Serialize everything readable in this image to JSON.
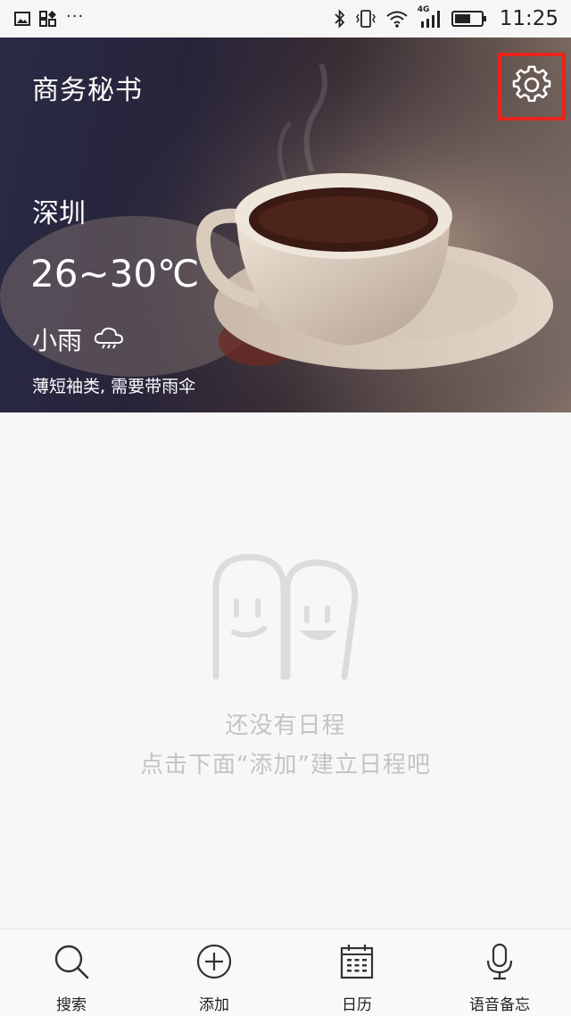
{
  "status_bar": {
    "time": "11:25",
    "dots": "···",
    "network": "4G",
    "icons": [
      "image-icon",
      "apps-icon",
      "bluetooth-icon",
      "vibrate-icon",
      "wifi-icon",
      "signal-icon",
      "battery-icon"
    ]
  },
  "header": {
    "title": "商务秘书",
    "settings_icon": "gear-icon",
    "highlight_color": "#e8241c"
  },
  "weather": {
    "city": "深圳",
    "temperature": "26~30℃",
    "condition": "小雨",
    "condition_icon": "cloud-rain-icon",
    "advice": "薄短袖类, 需要带雨伞"
  },
  "empty_state": {
    "illustration": "smiling-faces-icon",
    "title": "还没有日程",
    "subtitle": "点击下面“添加”建立日程吧"
  },
  "bottom_nav": {
    "items": [
      {
        "label": "搜索",
        "icon": "search-icon"
      },
      {
        "label": "添加",
        "icon": "add-circle-icon"
      },
      {
        "label": "日历",
        "icon": "calendar-icon"
      },
      {
        "label": "语音备忘",
        "icon": "microphone-icon"
      }
    ]
  }
}
